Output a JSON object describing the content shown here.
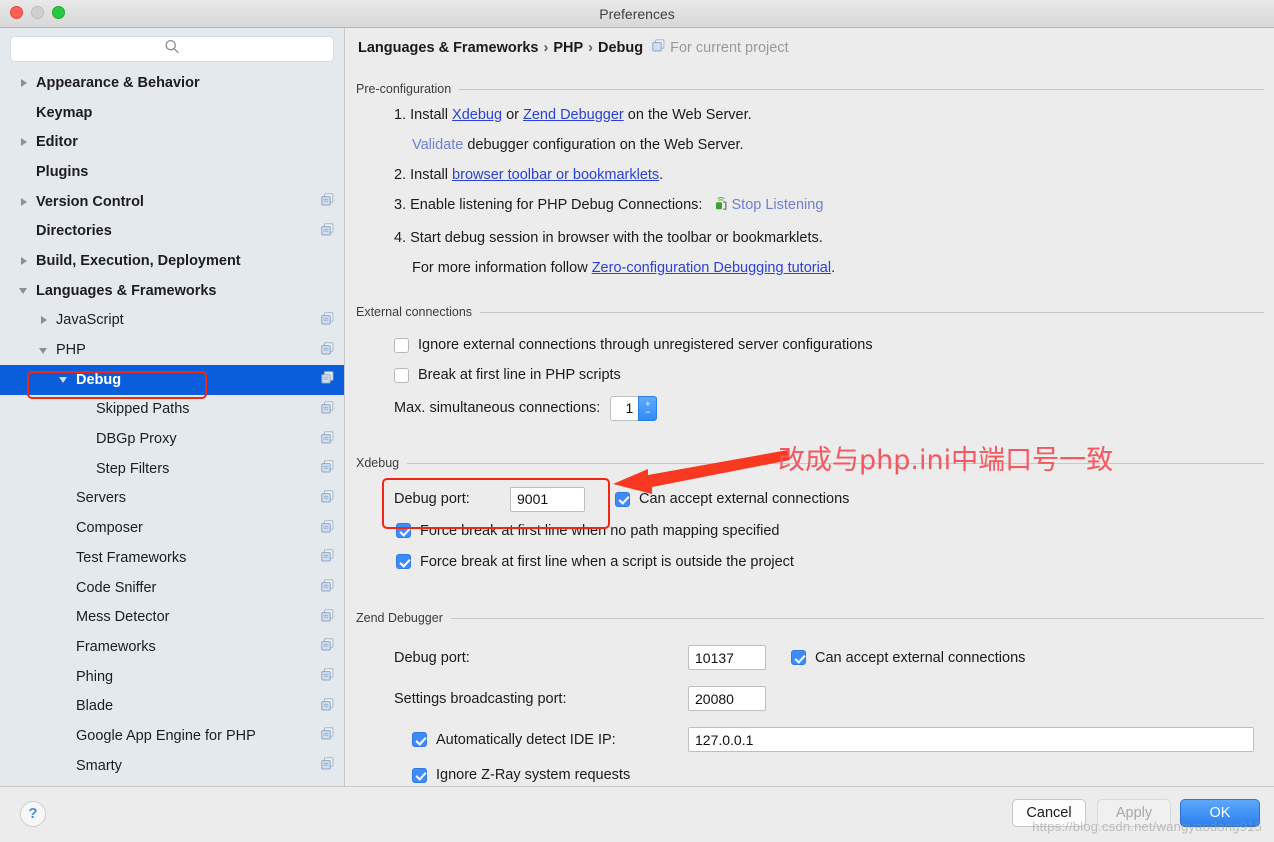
{
  "window": {
    "title": "Preferences"
  },
  "search": {
    "value": "",
    "placeholder": "",
    "icon": "search-icon"
  },
  "sidebar": {
    "items": [
      {
        "label": "Appearance & Behavior",
        "indent": 0,
        "twisty": "closed",
        "bold": true,
        "copy": false,
        "selected": false
      },
      {
        "label": "Keymap",
        "indent": 0,
        "twisty": "none",
        "bold": true,
        "copy": false,
        "selected": false
      },
      {
        "label": "Editor",
        "indent": 0,
        "twisty": "closed",
        "bold": true,
        "copy": false,
        "selected": false
      },
      {
        "label": "Plugins",
        "indent": 0,
        "twisty": "none",
        "bold": true,
        "copy": false,
        "selected": false
      },
      {
        "label": "Version Control",
        "indent": 0,
        "twisty": "closed",
        "bold": true,
        "copy": true,
        "selected": false
      },
      {
        "label": "Directories",
        "indent": 0,
        "twisty": "none",
        "bold": true,
        "copy": true,
        "selected": false
      },
      {
        "label": "Build, Execution, Deployment",
        "indent": 0,
        "twisty": "closed",
        "bold": true,
        "copy": false,
        "selected": false
      },
      {
        "label": "Languages & Frameworks",
        "indent": 0,
        "twisty": "open",
        "bold": true,
        "copy": false,
        "selected": false
      },
      {
        "label": "JavaScript",
        "indent": 1,
        "twisty": "closed",
        "bold": false,
        "copy": true,
        "selected": false
      },
      {
        "label": "PHP",
        "indent": 1,
        "twisty": "open",
        "bold": false,
        "copy": true,
        "selected": false
      },
      {
        "label": "Debug",
        "indent": 2,
        "twisty": "open",
        "bold": false,
        "copy": true,
        "selected": true
      },
      {
        "label": "Skipped Paths",
        "indent": 3,
        "twisty": "none",
        "bold": false,
        "copy": true,
        "selected": false
      },
      {
        "label": "DBGp Proxy",
        "indent": 3,
        "twisty": "none",
        "bold": false,
        "copy": true,
        "selected": false
      },
      {
        "label": "Step Filters",
        "indent": 3,
        "twisty": "none",
        "bold": false,
        "copy": true,
        "selected": false
      },
      {
        "label": "Servers",
        "indent": 2,
        "twisty": "none",
        "bold": false,
        "copy": true,
        "selected": false
      },
      {
        "label": "Composer",
        "indent": 2,
        "twisty": "none",
        "bold": false,
        "copy": true,
        "selected": false
      },
      {
        "label": "Test Frameworks",
        "indent": 2,
        "twisty": "none",
        "bold": false,
        "copy": true,
        "selected": false
      },
      {
        "label": "Code Sniffer",
        "indent": 2,
        "twisty": "none",
        "bold": false,
        "copy": true,
        "selected": false
      },
      {
        "label": "Mess Detector",
        "indent": 2,
        "twisty": "none",
        "bold": false,
        "copy": true,
        "selected": false
      },
      {
        "label": "Frameworks",
        "indent": 2,
        "twisty": "none",
        "bold": false,
        "copy": true,
        "selected": false
      },
      {
        "label": "Phing",
        "indent": 2,
        "twisty": "none",
        "bold": false,
        "copy": true,
        "selected": false
      },
      {
        "label": "Blade",
        "indent": 2,
        "twisty": "none",
        "bold": false,
        "copy": true,
        "selected": false
      },
      {
        "label": "Google App Engine for PHP",
        "indent": 2,
        "twisty": "none",
        "bold": false,
        "copy": true,
        "selected": false
      },
      {
        "label": "Smarty",
        "indent": 2,
        "twisty": "none",
        "bold": false,
        "copy": true,
        "selected": false
      }
    ]
  },
  "breadcrumb": {
    "part1": "Languages & Frameworks",
    "sep1": "›",
    "part2": "PHP",
    "sep2": "›",
    "part3": "Debug",
    "scope": "For current project"
  },
  "preconfiguration": {
    "title": "Pre-configuration",
    "s1_num": "1.",
    "s1_a": "Install ",
    "s1_link1": "Xdebug",
    "s1_b": " or ",
    "s1_link2": "Zend Debugger",
    "s1_c": " on the Web Server.",
    "s1b_link": "Validate",
    "s1b_text": " debugger configuration on the Web Server.",
    "s2_num": "2.",
    "s2_a": "Install ",
    "s2_link": "browser toolbar or bookmarklets",
    "s2_b": ".",
    "s3_num": "3.",
    "s3_a": "Enable listening for PHP Debug Connections:",
    "s3_action": "Stop Listening",
    "s4_num": "4.",
    "s4_a": "Start debug session in browser with the toolbar or bookmarklets.",
    "s4b_a": "For more information follow ",
    "s4b_link": "Zero-configuration Debugging tutorial",
    "s4b_b": "."
  },
  "external_connections": {
    "title": "External connections",
    "cb_ignore": {
      "label": "Ignore external connections through unregistered server configurations",
      "checked": false
    },
    "cb_break": {
      "label": "Break at first line in PHP scripts",
      "checked": false
    },
    "max_label": "Max. simultaneous connections:",
    "max_value": "1",
    "stepper_up": "+",
    "stepper_down": "−"
  },
  "xdebug": {
    "title": "Xdebug",
    "port_label": "Debug port:",
    "port_value": "9001",
    "cb_accept": {
      "label": "Can accept external connections",
      "checked": true
    },
    "cb_force_nopath": {
      "label": "Force break at first line when no path mapping specified",
      "checked": true
    },
    "cb_force_outside": {
      "label": "Force break at first line when a script is outside the project",
      "checked": true
    }
  },
  "zend": {
    "title": "Zend Debugger",
    "port_label": "Debug port:",
    "port_value": "10137",
    "cb_accept": {
      "label": "Can accept external connections",
      "checked": true
    },
    "broadcast_label": "Settings broadcasting port:",
    "broadcast_value": "20080",
    "cb_autodetect": {
      "label": "Automatically detect IDE IP:",
      "checked": true
    },
    "ip_value": "127.0.0.1",
    "cb_zray": {
      "label": "Ignore Z-Ray system requests",
      "checked": true
    }
  },
  "annotation": {
    "text": "改成与php.ini中端口号一致",
    "color": "#f5575f"
  },
  "footer": {
    "help": "?",
    "cancel": "Cancel",
    "apply": "Apply",
    "ok": "OK",
    "watermark": "https://blog.csdn.net/wangyaodong915"
  }
}
